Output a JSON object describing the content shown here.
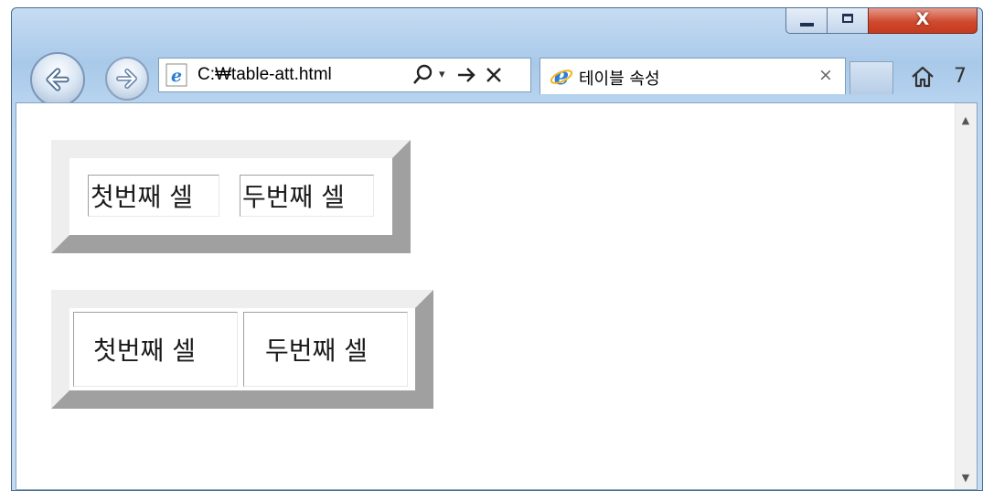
{
  "browser": {
    "address_url": "C:₩table-att.html",
    "tab_title": "테이블 속성",
    "tab_close_glyph": "×",
    "close_glyph": "X",
    "truncated_glyph": "7"
  },
  "icons": {
    "back": "back-arrow-icon",
    "forward": "forward-arrow-icon",
    "page": "ie-page-icon",
    "search": "search-icon",
    "dropdown": "chevron-down-icon",
    "go": "go-arrow-icon",
    "stop": "stop-icon",
    "home": "home-icon"
  },
  "content": {
    "table1": {
      "cells": [
        "첫번째 셀",
        "두번째 셀"
      ]
    },
    "table2": {
      "cells": [
        "첫번째 셀",
        "두번째 셀"
      ]
    }
  },
  "colors": {
    "chrome": "#b9d5f0",
    "close_button": "#cf4a2f",
    "table_border_light": "#eeeeee",
    "table_border_dark": "#a0a0a0",
    "ie_blue": "#2a7fd4"
  }
}
